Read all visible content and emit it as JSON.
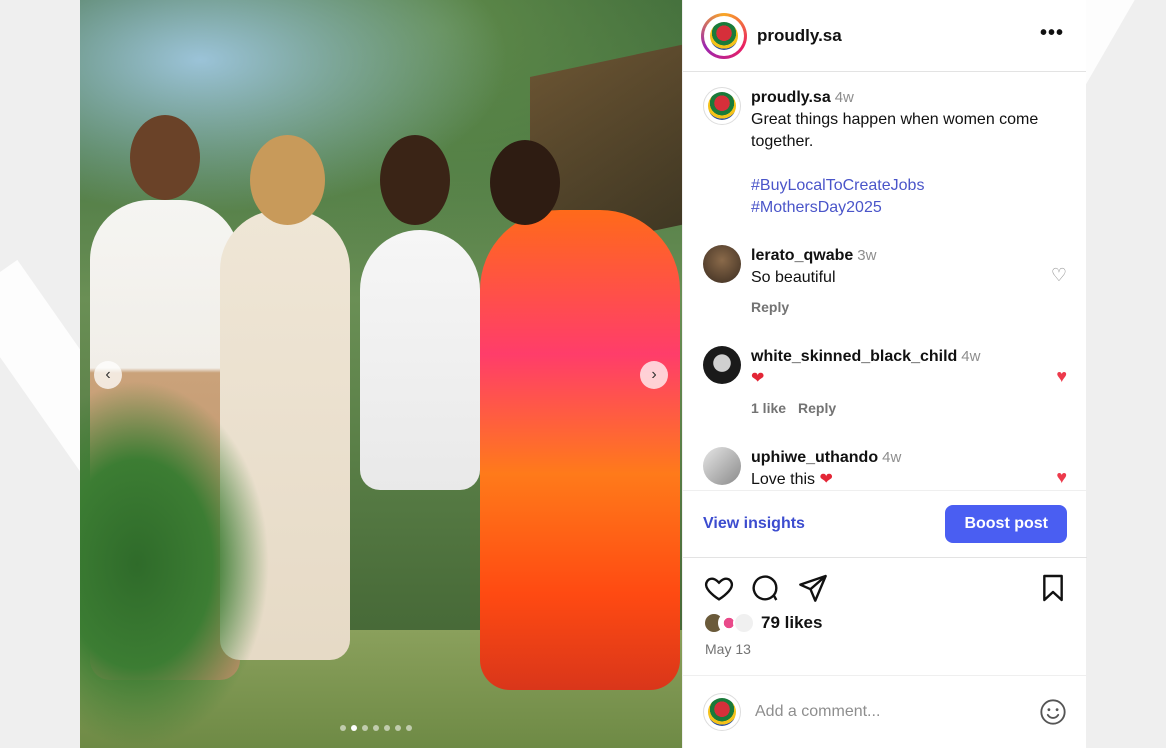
{
  "header": {
    "username": "proudly.sa",
    "more_label": "•••"
  },
  "caption": {
    "username": "proudly.sa",
    "time": "4w",
    "text": "Great things happen when women come together.",
    "hashtags": [
      "#BuyLocalToCreateJobs",
      "#MothersDay2025"
    ]
  },
  "comments": [
    {
      "username": "lerato_qwabe",
      "time": "3w",
      "text": "So beautiful",
      "likes": "",
      "reply": "Reply",
      "liked": false
    },
    {
      "username": "white_skinned_black_child",
      "time": "4w",
      "text": "",
      "likes": "1 like",
      "reply": "Reply",
      "liked": true
    },
    {
      "username": "uphiwe_uthando",
      "time": "4w",
      "text": "Love this",
      "likes": "",
      "reply": "",
      "liked": true
    }
  ],
  "insights": {
    "link": "View insights",
    "boost": "Boost post"
  },
  "post": {
    "likes": "79 likes",
    "date": "May 13"
  },
  "add_comment": {
    "placeholder": "Add a comment..."
  },
  "carousel": {
    "slides": 7,
    "active": 1
  },
  "colors": {
    "accent": "#4a5ef2",
    "link": "#3c4ccf",
    "like_red": "#ed3a4c"
  },
  "icons": [
    "more-icon",
    "heart-icon",
    "comment-icon",
    "share-icon",
    "bookmark-icon",
    "smile-icon",
    "chevron-left-icon",
    "chevron-right-icon"
  ]
}
